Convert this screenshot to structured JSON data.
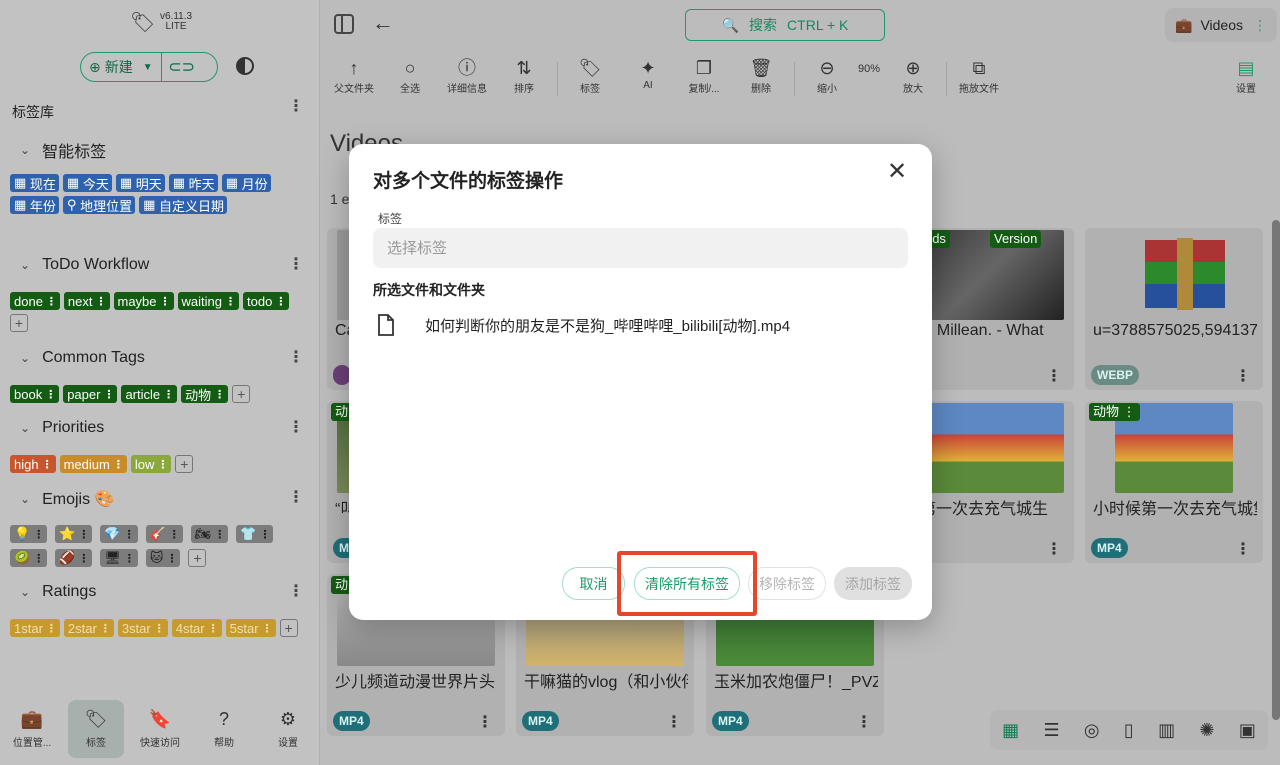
{
  "app": {
    "version": "v6.11.3",
    "edition": "LITE"
  },
  "sidebar": {
    "new_label": "新建",
    "library_title": "标签库",
    "groups": [
      {
        "title": "智能标签",
        "tags": [
          "现在",
          "今天",
          "明天",
          "昨天",
          "月份",
          "年份",
          "地理位置",
          "自定义日期"
        ]
      },
      {
        "title": "ToDo Workflow",
        "tags": [
          "done",
          "next",
          "maybe",
          "waiting",
          "todo"
        ]
      },
      {
        "title": "Common Tags",
        "tags": [
          "book",
          "paper",
          "article",
          "动物"
        ]
      },
      {
        "title": "Priorities",
        "tags": [
          "high",
          "medium",
          "low"
        ]
      },
      {
        "title": "Emojis 🎨",
        "tags": [
          "💡",
          "⭐",
          "💎",
          "🎸",
          "🏍",
          "👕",
          "🥝",
          "🏈",
          "🖥",
          "🐱"
        ]
      },
      {
        "title": "Ratings",
        "tags": [
          "1star",
          "2star",
          "3star",
          "4star",
          "5star"
        ]
      }
    ],
    "nav": [
      {
        "label": "位置管...",
        "icon": "briefcase-icon"
      },
      {
        "label": "标签",
        "icon": "tag-icon"
      },
      {
        "label": "快速访问",
        "icon": "bookmarks-icon"
      },
      {
        "label": "帮助",
        "icon": "help-icon"
      },
      {
        "label": "设置",
        "icon": "gear-icon"
      }
    ]
  },
  "topbar": {
    "search_label": "搜索",
    "search_shortcut": "CTRL + K",
    "location": "Videos"
  },
  "toolbar": {
    "parent": "父文件夹",
    "select_all": "全选",
    "details": "详细信息",
    "sort": "排序",
    "tag": "标签",
    "ai": "AI",
    "copy": "复制/...",
    "delete": "删除",
    "zoom_out": "缩小",
    "zoom": "90%",
    "zoom_in": "放大",
    "drop": "拖放文件",
    "settings": "设置"
  },
  "main": {
    "heading": "Videos",
    "count": "1 e"
  },
  "cards": [
    {
      "title": "Ca",
      "ext": ""
    },
    {
      "title": "AM, Millean. - What",
      "ext": "",
      "tags": [
        "nsheds",
        "Version"
      ]
    },
    {
      "title": "u=3788575025,594137",
      "ext": "WEBP"
    },
    {
      "title": "“叫",
      "ext": "MP4",
      "tags": [
        "动"
      ]
    },
    {
      "title": "候第一次去充气城生",
      "ext": "MP4"
    },
    {
      "title": "小时候第一次去充气城堡",
      "ext": "MP4",
      "tags": [
        "动物"
      ]
    },
    {
      "title": "少儿频道动漫世界片头",
      "ext": "MP4",
      "tags": [
        "动"
      ]
    },
    {
      "title": "干嘛猫的vlog（和小伙伴",
      "ext": "MP4"
    },
    {
      "title": "玉米加农炮僵尸！_PVZ",
      "ext": "MP4"
    }
  ],
  "modal": {
    "title": "对多个文件的标签操作",
    "tags_label": "标签",
    "tags_placeholder": "选择标签",
    "section_title": "所选文件和文件夹",
    "file_name": "如何判断你的朋友是不是狗_哔哩哔哩_bilibili[动物].mp4",
    "buttons": {
      "cancel": "取消",
      "clear_all": "清除所有标签",
      "remove": "移除标签",
      "add": "添加标签"
    }
  },
  "colors": {
    "accent": "#1e9a6a",
    "highlight": "#e8452f",
    "smart_tag": "#2f62ad",
    "tag_green": "#145c14"
  }
}
